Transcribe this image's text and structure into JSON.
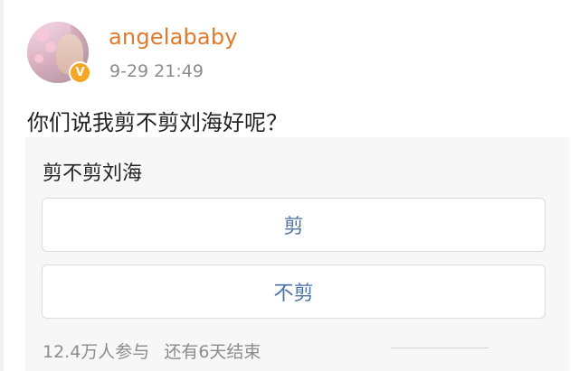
{
  "post": {
    "username": "angelababy",
    "timestamp": "9-29 21:49",
    "verified_badge": "V",
    "text": "你们说我剪不剪刘海好呢？"
  },
  "poll": {
    "title": "剪不剪刘海",
    "options": [
      {
        "label": "剪"
      },
      {
        "label": "不剪"
      }
    ],
    "participants": "12.4万人参与",
    "remaining": "还有6天结束"
  },
  "colors": {
    "username": "#e07a2d",
    "option_text": "#4a72a6",
    "meta_text": "#8c8c8c",
    "badge": "#f5a623"
  }
}
